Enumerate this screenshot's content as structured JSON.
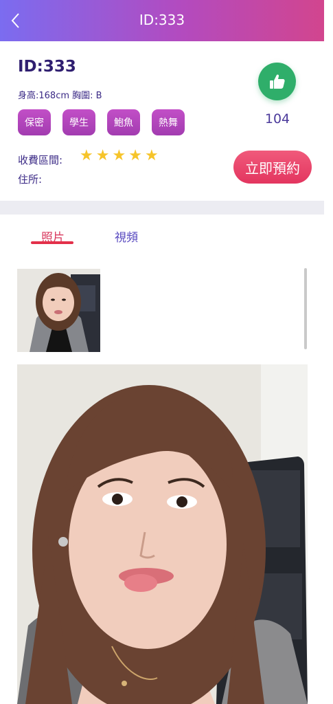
{
  "header": {
    "title": "ID:333"
  },
  "profile": {
    "id_text": "ID:333",
    "stats": "身高:168cm 胸圍: B",
    "tags": [
      "保密",
      "學生",
      "鮑魚",
      "熱舞"
    ],
    "likes": "104",
    "fee_label": "收費區間:",
    "address_label": "住所:",
    "rating": 5,
    "book_label": "立即預約"
  },
  "tabs": {
    "photo": "照片",
    "video": "視頻"
  },
  "colors": {
    "header_start": "#7b6cf0",
    "header_end": "#d2458e",
    "accent_text": "#2f1e70",
    "tag": "#b043bb",
    "like": "#2fae6a",
    "book": "#e3355f",
    "star": "#f6c42a"
  }
}
